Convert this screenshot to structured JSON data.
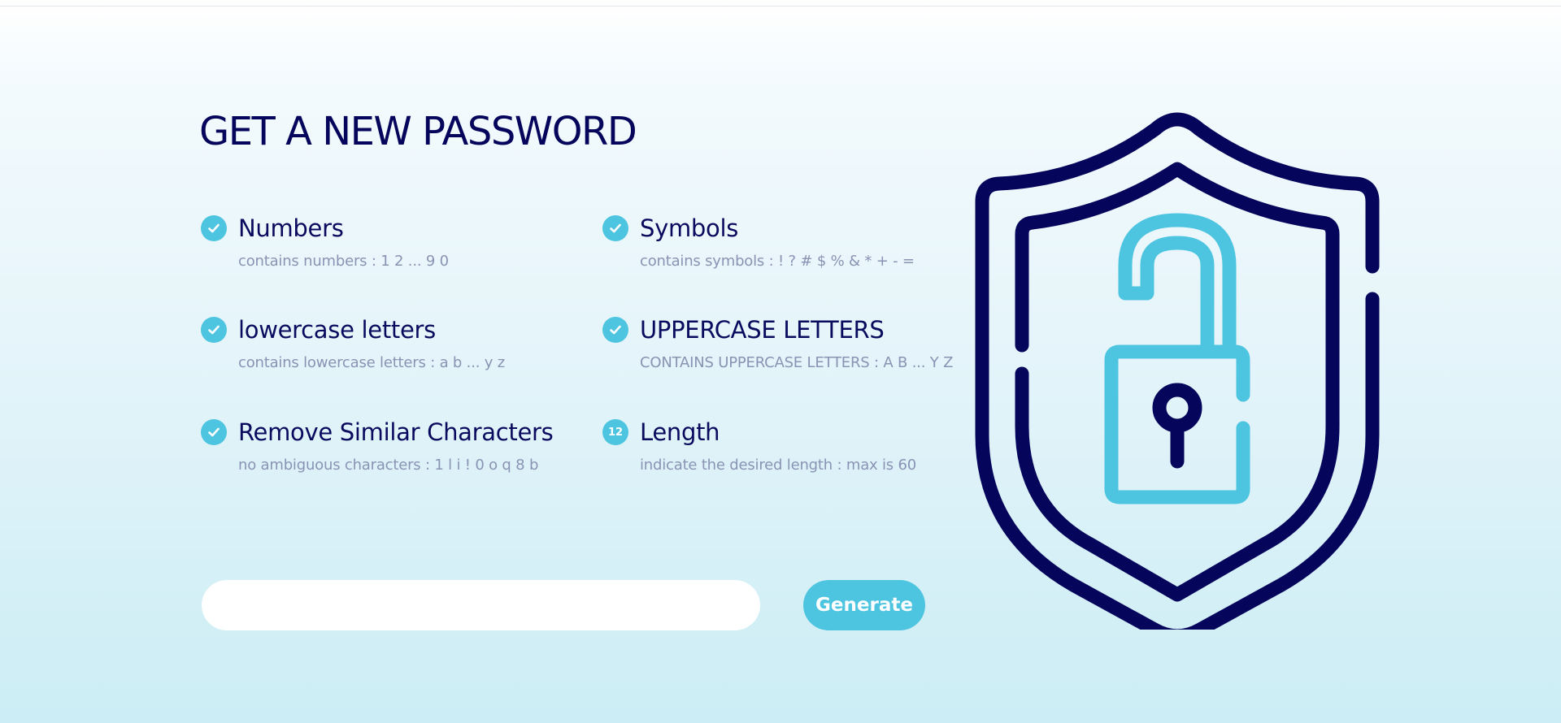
{
  "page": {
    "title": "GET A NEW PASSWORD"
  },
  "options": {
    "numbers": {
      "title": "Numbers",
      "description": "contains numbers : 1 2 ... 9 0",
      "checked": true
    },
    "symbols": {
      "title": "Symbols",
      "description": "contains symbols : ! ? # $ % & * + - =",
      "checked": true
    },
    "lowercase": {
      "title": "lowercase letters",
      "description": "contains lowercase letters : a b ... y z",
      "checked": true
    },
    "uppercase": {
      "title": "UPPERCASE LETTERS",
      "description": "CONTAINS UPPERCASE LETTERS : A B ... Y Z",
      "checked": true
    },
    "similar": {
      "title": "Remove Similar Characters",
      "description": "no ambiguous characters : 1 l i ! 0 o q 8 b",
      "checked": true
    },
    "length": {
      "title": "Length",
      "description": "indicate the desired length : max is 60",
      "value": "12"
    }
  },
  "password_field": {
    "value": "",
    "placeholder": ""
  },
  "generate_button": {
    "label": "Generate"
  },
  "illustration": {
    "icon": "shield-unlocked-padlock-icon"
  },
  "colors": {
    "navy": "#05055c",
    "accent": "#4ec5e0",
    "muted_text": "#8a93b3",
    "input_bg": "#ffffff"
  }
}
